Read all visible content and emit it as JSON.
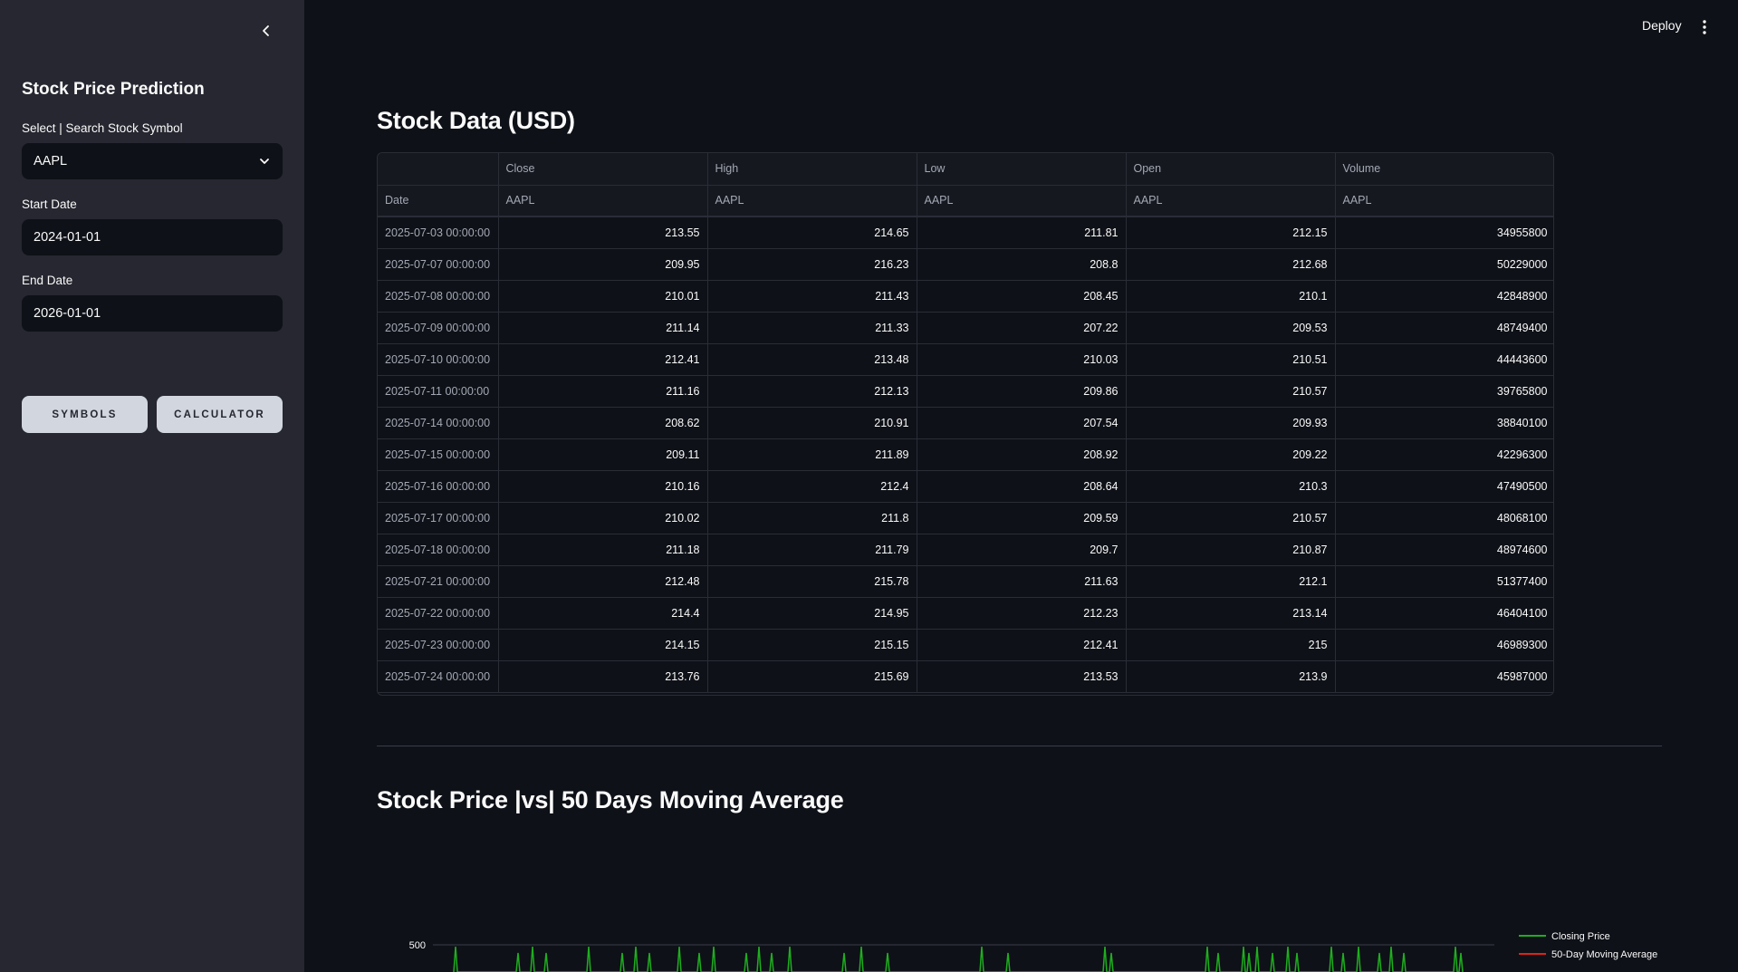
{
  "sidebar": {
    "title": "Stock Price Prediction",
    "symbol_label": "Select | Search Stock Symbol",
    "symbol_value": "AAPL",
    "start_label": "Start Date",
    "start_value": "2024-01-01",
    "end_label": "End Date",
    "end_value": "2026-01-01",
    "symbols_button": "SYMBOLS",
    "calculator_button": "CALCULATOR"
  },
  "topbar": {
    "deploy": "Deploy"
  },
  "table_section": {
    "title": "Stock Data (USD)",
    "columns": [
      {
        "name": "Close",
        "sub": "AAPL"
      },
      {
        "name": "High",
        "sub": "AAPL"
      },
      {
        "name": "Low",
        "sub": "AAPL"
      },
      {
        "name": "Open",
        "sub": "AAPL"
      },
      {
        "name": "Volume",
        "sub": "AAPL"
      }
    ],
    "index_header": "Date",
    "rows": [
      {
        "date": "2025-07-03 00:00:00",
        "close": "213.55",
        "high": "214.65",
        "low": "211.81",
        "open": "212.15",
        "volume": "34955800"
      },
      {
        "date": "2025-07-07 00:00:00",
        "close": "209.95",
        "high": "216.23",
        "low": "208.8",
        "open": "212.68",
        "volume": "50229000"
      },
      {
        "date": "2025-07-08 00:00:00",
        "close": "210.01",
        "high": "211.43",
        "low": "208.45",
        "open": "210.1",
        "volume": "42848900"
      },
      {
        "date": "2025-07-09 00:00:00",
        "close": "211.14",
        "high": "211.33",
        "low": "207.22",
        "open": "209.53",
        "volume": "48749400"
      },
      {
        "date": "2025-07-10 00:00:00",
        "close": "212.41",
        "high": "213.48",
        "low": "210.03",
        "open": "210.51",
        "volume": "44443600"
      },
      {
        "date": "2025-07-11 00:00:00",
        "close": "211.16",
        "high": "212.13",
        "low": "209.86",
        "open": "210.57",
        "volume": "39765800"
      },
      {
        "date": "2025-07-14 00:00:00",
        "close": "208.62",
        "high": "210.91",
        "low": "207.54",
        "open": "209.93",
        "volume": "38840100"
      },
      {
        "date": "2025-07-15 00:00:00",
        "close": "209.11",
        "high": "211.89",
        "low": "208.92",
        "open": "209.22",
        "volume": "42296300"
      },
      {
        "date": "2025-07-16 00:00:00",
        "close": "210.16",
        "high": "212.4",
        "low": "208.64",
        "open": "210.3",
        "volume": "47490500"
      },
      {
        "date": "2025-07-17 00:00:00",
        "close": "210.02",
        "high": "211.8",
        "low": "209.59",
        "open": "210.57",
        "volume": "48068100"
      },
      {
        "date": "2025-07-18 00:00:00",
        "close": "211.18",
        "high": "211.79",
        "low": "209.7",
        "open": "210.87",
        "volume": "48974600"
      },
      {
        "date": "2025-07-21 00:00:00",
        "close": "212.48",
        "high": "215.78",
        "low": "211.63",
        "open": "212.1",
        "volume": "51377400"
      },
      {
        "date": "2025-07-22 00:00:00",
        "close": "214.4",
        "high": "214.95",
        "low": "212.23",
        "open": "213.14",
        "volume": "46404100"
      },
      {
        "date": "2025-07-23 00:00:00",
        "close": "214.15",
        "high": "215.15",
        "low": "212.41",
        "open": "215",
        "volume": "46989300"
      },
      {
        "date": "2025-07-24 00:00:00",
        "close": "213.76",
        "high": "215.69",
        "low": "213.53",
        "open": "213.9",
        "volume": "45987000"
      }
    ]
  },
  "chart_section": {
    "title": "Stock Price |vs| 50 Days Moving Average"
  },
  "chart_data": {
    "type": "line",
    "yticks": [
      "500"
    ],
    "series": [
      {
        "name": "Closing Price",
        "color": "#1fae1f"
      },
      {
        "name": "50-Day Moving Average",
        "color": "#e0221a"
      }
    ]
  },
  "colors": {
    "background": "#0e1117",
    "sidebar": "#262730",
    "button": "#d2d6de"
  }
}
